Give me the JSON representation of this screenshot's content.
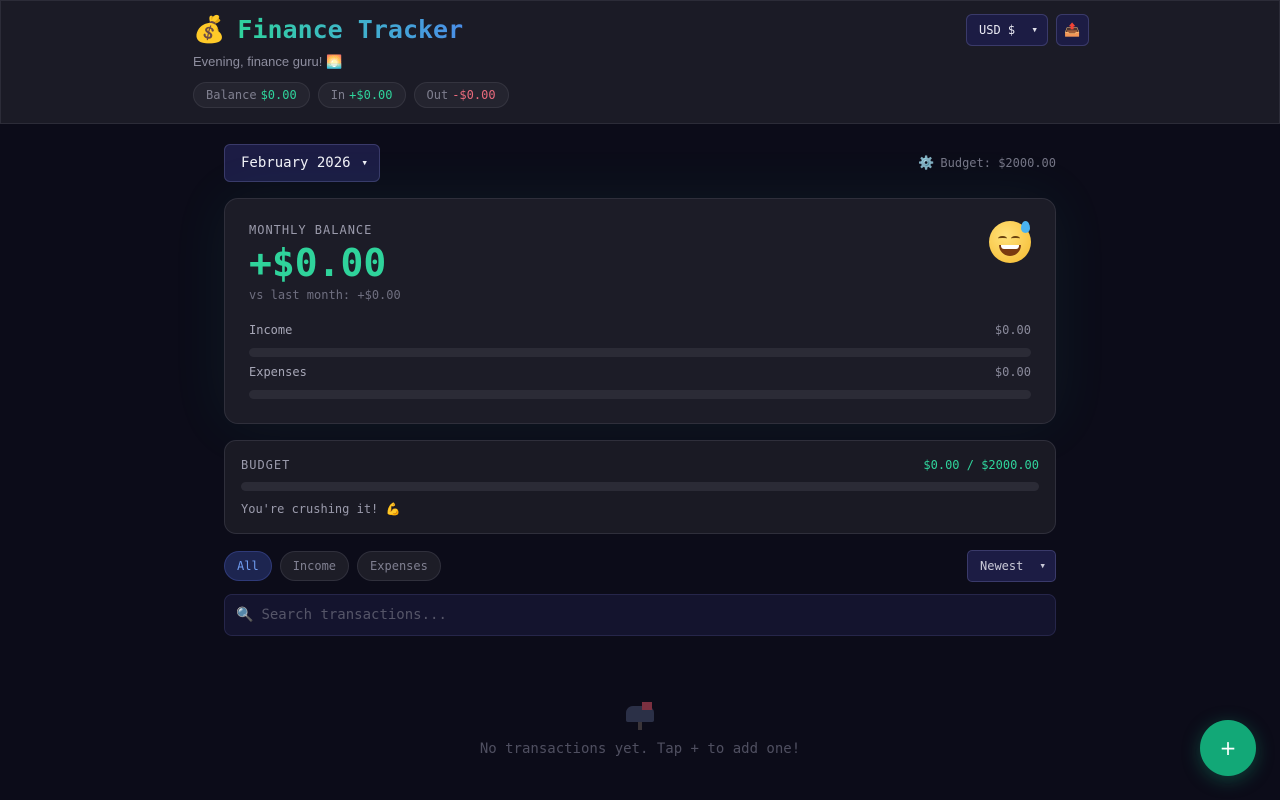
{
  "header": {
    "app_icon": "money-bag-icon",
    "title": "Finance Tracker",
    "greeting": "Evening, finance guru! 🌅",
    "pills": {
      "balance_label": "Balance",
      "balance_value": "$0.00",
      "in_label": "In",
      "in_value": "+$0.00",
      "out_label": "Out",
      "out_value": "-$0.00"
    },
    "currency_select": {
      "value": "USD $",
      "chevron": "▾"
    },
    "export_icon": "📤"
  },
  "toolbar": {
    "month_select": {
      "value": "February 2026",
      "chevron": "▾"
    },
    "budget_settings": {
      "icon": "⚙️",
      "label": "Budget: $2000.00"
    }
  },
  "monthly": {
    "label": "MONTHLY BALANCE",
    "amount": "+$0.00",
    "compare": "vs last month: +$0.00",
    "mood_icon": "grinning-sweat-face-icon",
    "income": {
      "label": "Income",
      "value": "$0.00",
      "fraction": 0
    },
    "expenses": {
      "label": "Expenses",
      "value": "$0.00",
      "fraction": 0
    }
  },
  "budget": {
    "title": "BUDGET",
    "amount": "$0.00 / $2000.00",
    "fraction": 0,
    "message": "You're crushing it! ",
    "message_icon": "💪"
  },
  "filters": {
    "all": "All",
    "income": "Income",
    "expenses": "Expenses",
    "active": "All"
  },
  "sort_select": {
    "value": "Newest",
    "chevron": "▾"
  },
  "search": {
    "icon": "🔍",
    "placeholder": "Search transactions..."
  },
  "empty": {
    "icon": "mailbox-icon",
    "text": "No transactions yet. Tap + to add one!"
  },
  "fab": {
    "label": "+"
  },
  "colors": {
    "background": "#0c0c19",
    "accent_green": "#2fd39b",
    "negative_red": "#e96a7c",
    "active_chip_blue": "#6f9cf0",
    "fab": "#12a877"
  }
}
